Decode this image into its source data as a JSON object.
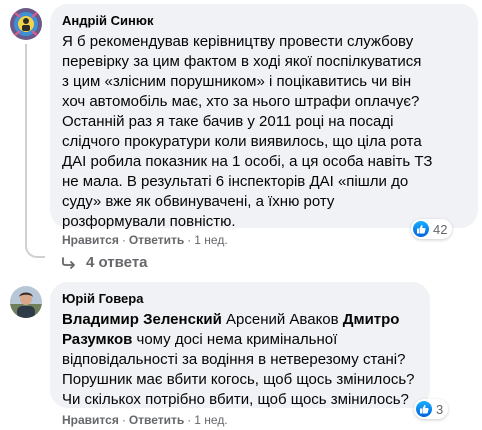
{
  "comment1": {
    "author": "Андрій Синюк",
    "text_lines": [
      "Я б рекомендував керівництву провести службову",
      "перевірку за цим фактом в ході якої поспілкуватися",
      "з цим «злісним порушником» і поцікавитись чи він",
      "хоч автомобіль має, хто за нього штрафи оплачує?",
      "Останній раз я таке бачив у 2011 році на посаді",
      "слідчого прокуратури коли виявилось, що ціла рота",
      "ДАІ робила показник на 1 особі, а ця особа навіть ТЗ",
      "не мала. В результаті 6 інспекторів ДАІ «пішли до",
      "суду» вже як обвинувачені, а їхню роту",
      "розформували повністю."
    ],
    "like_label": "Нравится",
    "reply_label": "Ответить",
    "time": "1 нед.",
    "reaction_count": "42"
  },
  "replies": {
    "label": "4 ответа"
  },
  "comment2": {
    "author": "Юрій Говера",
    "mention1": "Владимир Зеленский",
    "mention2_plain": "Арсений Аваков",
    "mention3_line1": "Дмитро",
    "mention3_line2": "Разумков",
    "text_line2_rest": " чому досі нема кримінальної",
    "text_lines": [
      "відповідальності за водіння в нетверезому стані?",
      "Порушник має вбити когось, щоб щось змінилось?",
      "Чи скількох потрібно вбити, щоб щось змінилось?"
    ],
    "like_label": "Нравится",
    "reply_label": "Ответить",
    "time": "1 нед.",
    "reaction_count": "3"
  },
  "colors": {
    "bubble": "#f0f2f5",
    "meta_text": "#65676b",
    "like_blue": "#1877f2"
  }
}
